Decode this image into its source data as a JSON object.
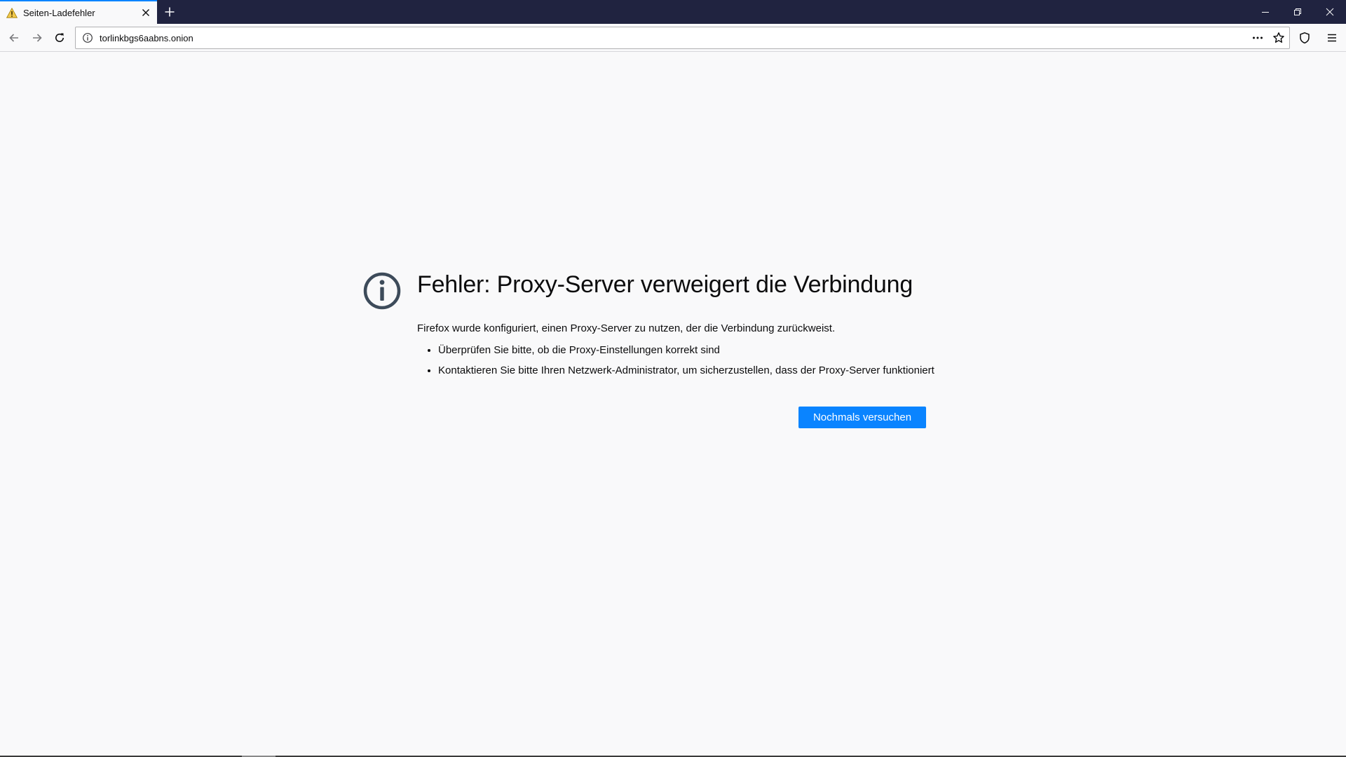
{
  "browser": {
    "tab": {
      "title": "Seiten-Ladefehler",
      "icon": "warning-icon"
    },
    "new_tab_icon": "plus-icon",
    "window_controls": [
      "minimize-icon",
      "restore-icon",
      "close-icon"
    ],
    "nav": {
      "back_icon": "back-arrow-icon",
      "forward_icon": "forward-arrow-icon",
      "reload_icon": "reload-icon"
    },
    "urlbar": {
      "url": "torlinkbgs6aabns.onion",
      "info_icon": "info-icon",
      "page_actions_icon": "more-dots-icon",
      "bookmark_icon": "star-icon"
    },
    "toolbar_icons": [
      "shield-icon",
      "hamburger-menu-icon"
    ]
  },
  "error_page": {
    "icon": "info-circle-icon",
    "title": "Fehler: Proxy-Server verweigert die Verbindung",
    "description": "Firefox wurde konfiguriert, einen Proxy-Server zu nutzen, der die Verbindung zurückweist.",
    "suggestions": [
      "Überprüfen Sie bitte, ob die Proxy-Einstellungen korrekt sind",
      "Kontaktieren Sie bitte Ihren Netzwerk-Administrator, um sicherzustellen, dass der Proxy-Server funktioniert"
    ],
    "retry_label": "Nochmals versuchen"
  },
  "colors": {
    "tabstrip": "#202340",
    "accent": "#0a84ff",
    "page_background": "#f9f9fa",
    "text": "#0c0c0d"
  }
}
